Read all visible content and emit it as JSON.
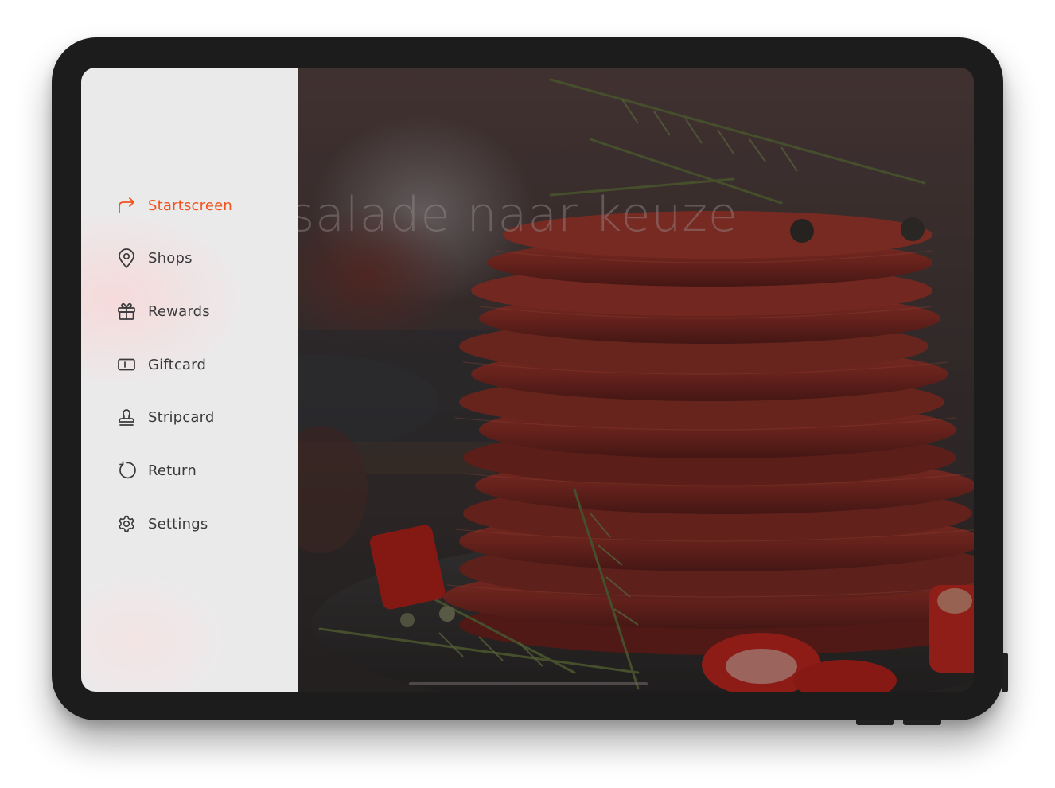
{
  "hero": {
    "text": "salade naar keuze"
  },
  "menu": {
    "active_color": "#f0541e",
    "text_color": "#3a3a3c",
    "items": [
      {
        "label": "Startscreen",
        "icon": "share-arrow-icon",
        "active": true
      },
      {
        "label": "Shops",
        "icon": "map-pin-icon",
        "active": false
      },
      {
        "label": "Rewards",
        "icon": "gift-icon",
        "active": false
      },
      {
        "label": "Giftcard",
        "icon": "card-icon",
        "active": false
      },
      {
        "label": "Stripcard",
        "icon": "stamp-icon",
        "active": false
      },
      {
        "label": "Return",
        "icon": "refresh-icon",
        "active": false
      },
      {
        "label": "Settings",
        "icon": "gear-icon",
        "active": false
      }
    ]
  }
}
